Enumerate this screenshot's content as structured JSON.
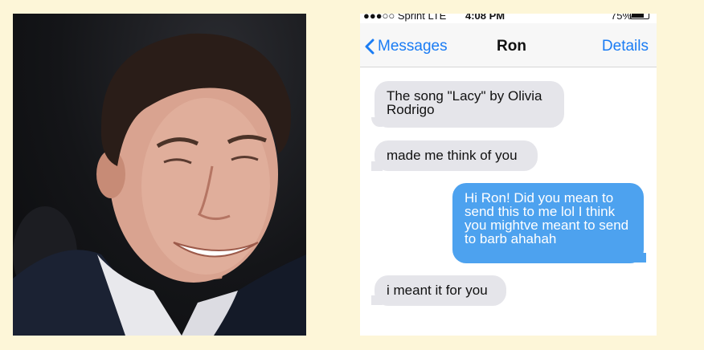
{
  "status_bar": {
    "carrier": "●●●○○ Sprint  LTE",
    "time": "4:08 PM",
    "battery": "75%"
  },
  "nav": {
    "back_label": "Messages",
    "contact_name": "Ron",
    "details_label": "Details"
  },
  "messages": [
    {
      "direction": "incoming",
      "text": "The song \"Lacy\" by Olivia Rodrigo"
    },
    {
      "direction": "incoming",
      "text": "made me think of you"
    },
    {
      "direction": "outgoing",
      "text": "Hi Ron! Did you mean to send this to me lol I think you mightve meant to send to barb ahahah"
    },
    {
      "direction": "incoming",
      "text": "i meant it for you"
    }
  ],
  "colors": {
    "background": "#fdf6d8",
    "incoming_bubble": "#e5e5ea",
    "outgoing_bubble": "#4da2ef",
    "link_blue": "#1a7cf4"
  }
}
